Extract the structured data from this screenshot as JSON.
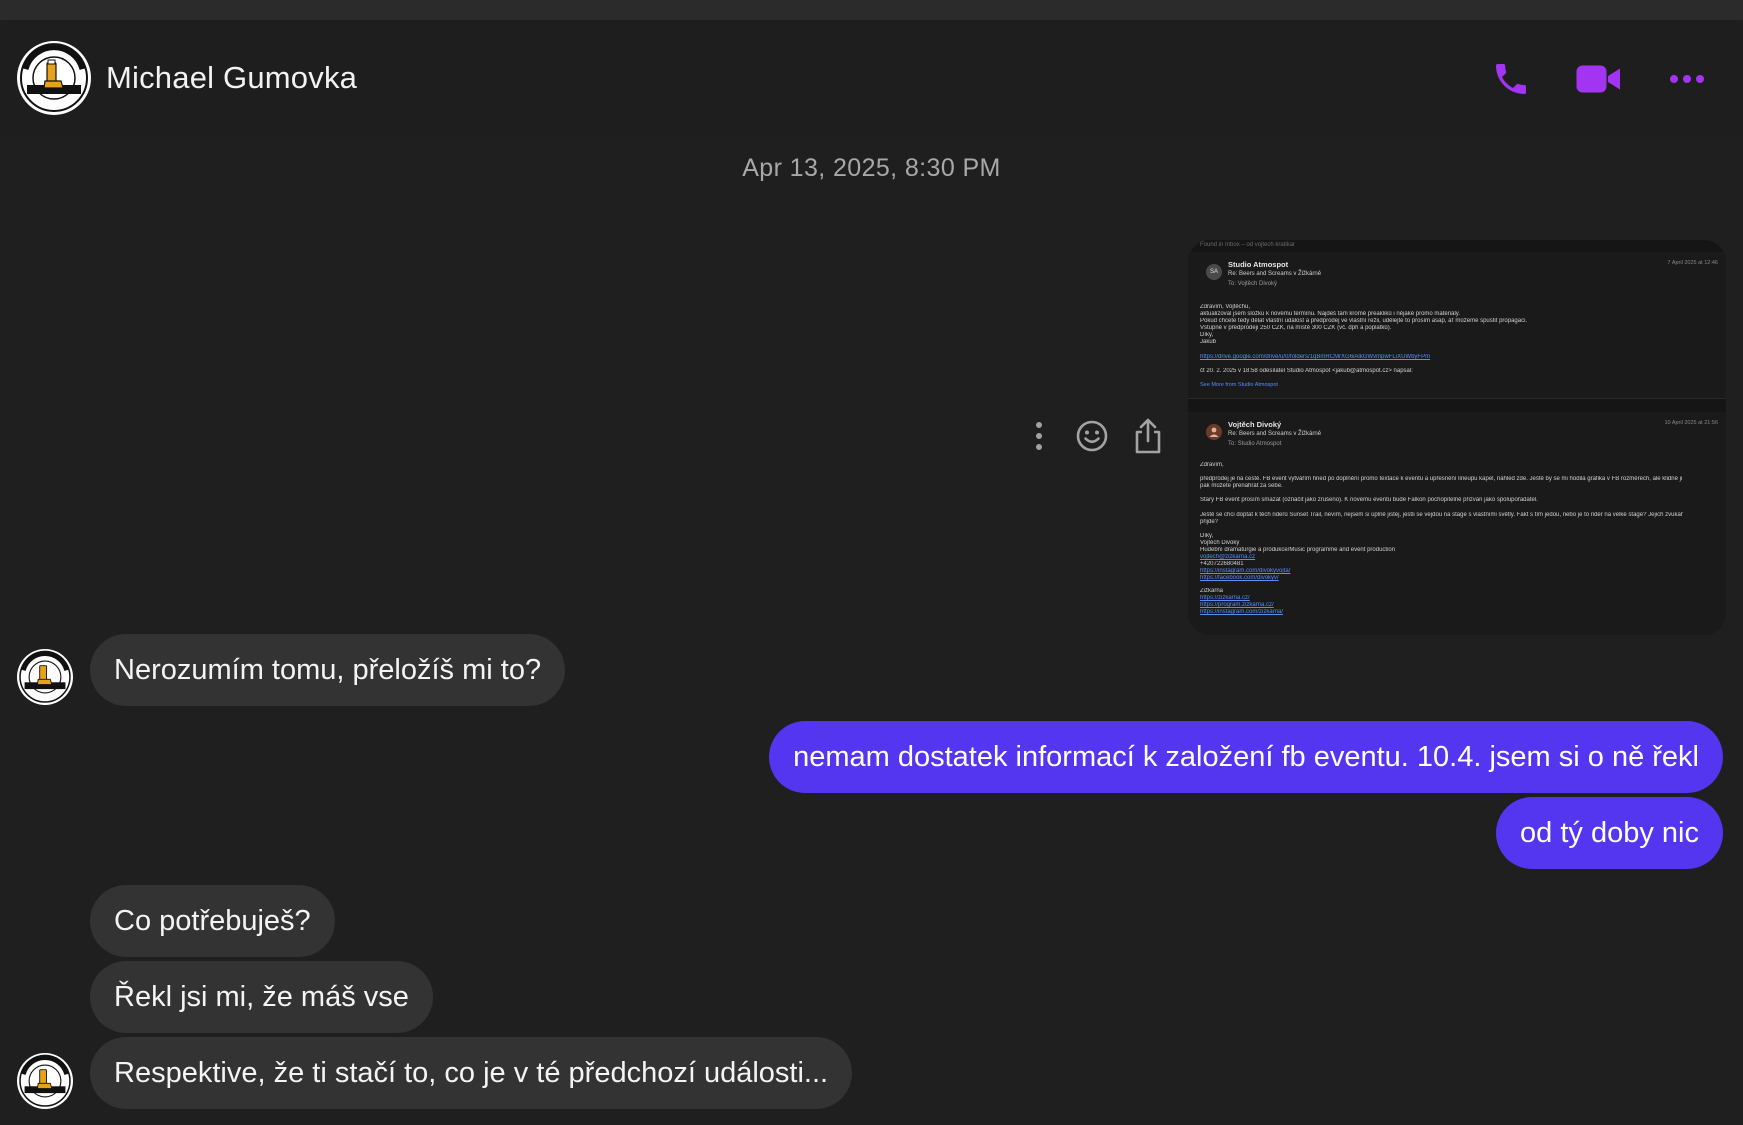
{
  "header": {
    "contact_name": "Michael Gumovka",
    "avatar_icon": "craft-beer-pub-logo",
    "avatar_text_top": "CRAFT BEER PUB",
    "avatar_text_bottom": "ŽIDOVSKÁ GUMOVKA",
    "actions": [
      {
        "icon": "phone-icon",
        "label": "Audio call"
      },
      {
        "icon": "video-camera-icon",
        "label": "Video call"
      },
      {
        "icon": "more-horizontal-icon",
        "label": "More"
      }
    ],
    "accent_color": "#a335f2"
  },
  "conversation": {
    "timestamp": "Apr 13, 2025, 8:30 PM",
    "message_actions": [
      "more-vertical-icon",
      "emoji-smile-icon",
      "share-icon"
    ],
    "attachment": {
      "hint": "Found in Inbox – od vojtech kratikar",
      "email1": {
        "avatar": "SA",
        "from": "Studio Atmospot",
        "subject": "Re: Beers and Screams v Žižkárně",
        "to": "To: Vojtěch Divoký",
        "date": "7 April 2025 at 12:46",
        "lines": [
          "Zdravím, Vojtěchu,",
          "aktualizoval jsem složku k novému termínu. Najdeš tam kromě preakliků i nějaké promo materiály.",
          "Pokud chcete tedy dělat vlastní událost a předprodej ve vlastní režii, udělejte to prosím asap, ať můžeme spustit propagaci.",
          "Vstupné v předprodeji 250 CZK, na místě 300 CZK (vč. dph a poplatků).",
          "Díky,",
          "Jakub"
        ],
        "link": "https://drive.google.com/drive/u/0/folders/1qBmRCMrXG6iAlkGWvmpwFLiXUWbyFPm",
        "quote": "čt 20. 2. 2025 v 18:58 odesílatel Studio Atmospot <jakub@atmospot.cz> napsal:",
        "see_more": "See More from Studio Atmospot"
      },
      "email2": {
        "from": "Vojtěch Divoký",
        "subject": "Re: Beers and Screams v Žižkárně",
        "to": "To: Studio Atmospot",
        "date": "10 April 2025 at 21:56",
        "lines": [
          "Zdravím,",
          "předprodej je na cestě. FB event vytvářím hned po doplnění promo textace k eventu a upřesnění lineupu kapel, náhled zde. Ještě by se mi hodila grafika v FB rozměrech, ale klidně ji",
          "pak můžete přenahrát za sebe.",
          "Starý FB event prosím smazat (označit jako zrušeno). K novému eventu bude Falkon pochopitelně přizván jako spolupořadatel.",
          "Ještě se chci doptat k těch riderů Sunset Trail, nevím, nejsem si úplně jistej, jestli se vejdou na stage s vlastními světly. Fakt s tím jedou, nebo je to rider na velké stage? Jejich zvukař",
          "přijde?",
          "Díky,",
          "Vojtěch Divoký",
          "Hudební dramaturgie a produkce/Music programme and event production"
        ],
        "links": [
          "vojtech@zizkarna.cz",
          "+420722680481",
          "https://instagram.com/divokyvojta/",
          "https://facebook.com/divokyv/",
          "Žižkárna",
          "https://zizkarna.cz/",
          "https://program.zizkarna.cz/",
          "https://instagram.com/zizkarna/"
        ]
      }
    },
    "messages": [
      {
        "dir": "in",
        "text": "Nerozumím tomu, přeložíš mi to?"
      },
      {
        "dir": "out",
        "text": "nemam dostatek informací k založení fb eventu. 10.4. jsem si o ně řekl"
      },
      {
        "dir": "out",
        "text": "od tý doby nic"
      },
      {
        "dir": "in",
        "text": "Co potřebuješ?"
      },
      {
        "dir": "in",
        "text": "Řekl jsi mi, že máš vse"
      },
      {
        "dir": "in",
        "text": "Respektive, že ti stačí to, co je v té předchozí události..."
      }
    ],
    "colors": {
      "incoming_bubble": "#333333",
      "outgoing_bubble": "#5436f0",
      "background": "#1f1f1f"
    }
  }
}
